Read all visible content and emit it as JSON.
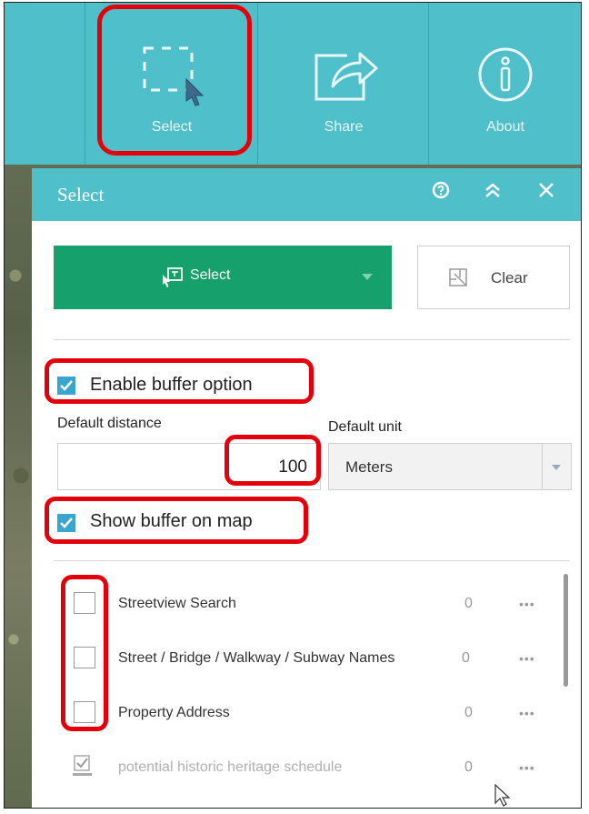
{
  "toolbar": {
    "tools": [
      {
        "label": "Select",
        "icon": "select-area-icon"
      },
      {
        "label": "Share",
        "icon": "share-icon"
      },
      {
        "label": "About",
        "icon": "info-icon"
      }
    ]
  },
  "panel": {
    "title": "Select",
    "header_icons": [
      "help-icon",
      "collapse-icon",
      "close-icon"
    ],
    "select_button": {
      "label": "Select",
      "icon": "select-tool-icon",
      "dropdown_icon": "caret-down-icon"
    },
    "clear_button": {
      "label": "Clear",
      "icon": "clear-selection-icon"
    },
    "buffer": {
      "enable_label": "Enable buffer option",
      "enable_checked": true,
      "distance_label": "Default distance",
      "distance_value": "100",
      "unit_label": "Default unit",
      "unit_value": "Meters",
      "show_label": "Show buffer on map",
      "show_checked": true
    },
    "layers": [
      {
        "name": "Streetview Search",
        "count": "0",
        "checked": false
      },
      {
        "name": "Street / Bridge / Walkway / Subway Names",
        "count": "0",
        "checked": false
      },
      {
        "name": "Property Address",
        "count": "0",
        "checked": false
      },
      {
        "name": "potential historic heritage schedule",
        "count": "0",
        "checked": true,
        "disabled": true
      }
    ],
    "more_label": "•••"
  },
  "colors": {
    "accent": "#4fbfc9",
    "select_green": "#16a06b",
    "highlight_red": "#e3000b",
    "checkbox_blue": "#3aa6cf"
  }
}
